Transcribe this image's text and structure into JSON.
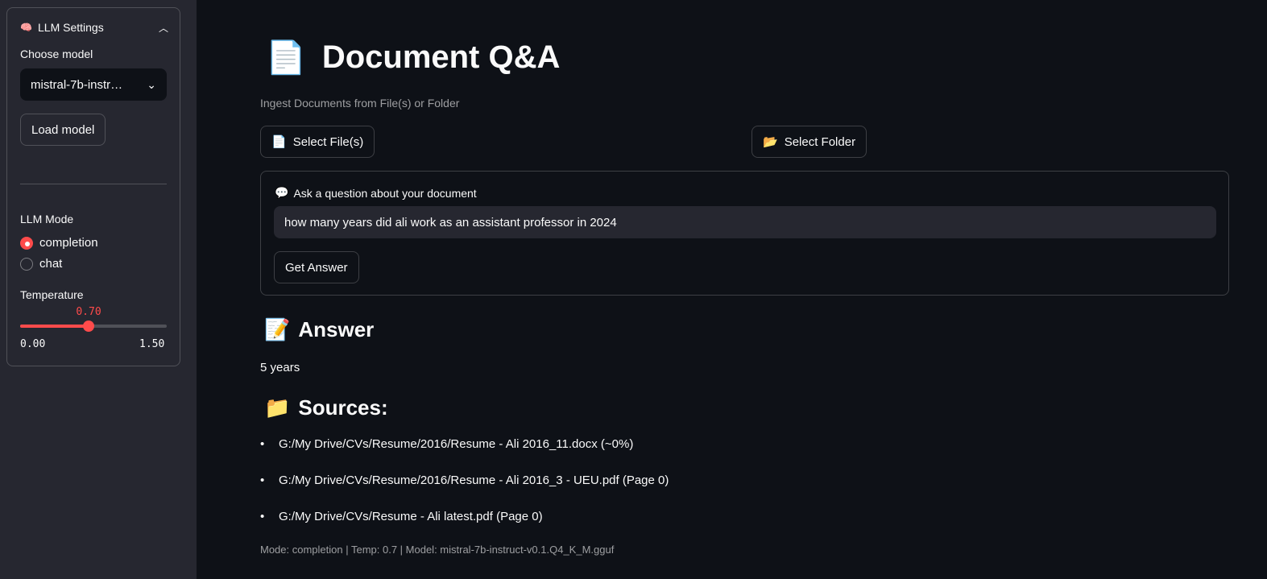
{
  "sidebar": {
    "expander_title": "LLM Settings",
    "expander_icon": "brain-icon",
    "model_label": "Choose model",
    "model_value": "mistral-7b-instr…",
    "load_button": "Load model",
    "mode_label": "LLM Mode",
    "modes": [
      {
        "label": "completion",
        "selected": true
      },
      {
        "label": "chat",
        "selected": false
      }
    ],
    "temperature_label": "Temperature",
    "temperature": {
      "value": "0.70",
      "min": "0.00",
      "max": "1.50",
      "fraction": 0.4667
    },
    "accent": "#ff4b4b"
  },
  "main": {
    "title": "Document Q&A",
    "title_icon": "page-icon",
    "caption": "Ingest Documents from File(s) or Folder",
    "select_files": "Select File(s)",
    "select_folder": "Select Folder",
    "question_label": "Ask a question about your document",
    "question_value": "how many years did ali work as an assistant professor in 2024",
    "get_answer": "Get Answer",
    "answer_heading": "Answer",
    "answer": "5 years",
    "sources_heading": "Sources:",
    "sources": [
      "G:/My Drive/CVs/Resume/2016/Resume - Ali 2016_11.docx (~0%)",
      "G:/My Drive/CVs/Resume/2016/Resume - Ali 2016_3 - UEU.pdf (Page 0)",
      "G:/My Drive/CVs/Resume - Ali latest.pdf (Page 0)"
    ],
    "footer": "Mode: completion | Temp: 0.7 | Model: mistral-7b-instruct-v0.1.Q4_K_M.gguf"
  }
}
